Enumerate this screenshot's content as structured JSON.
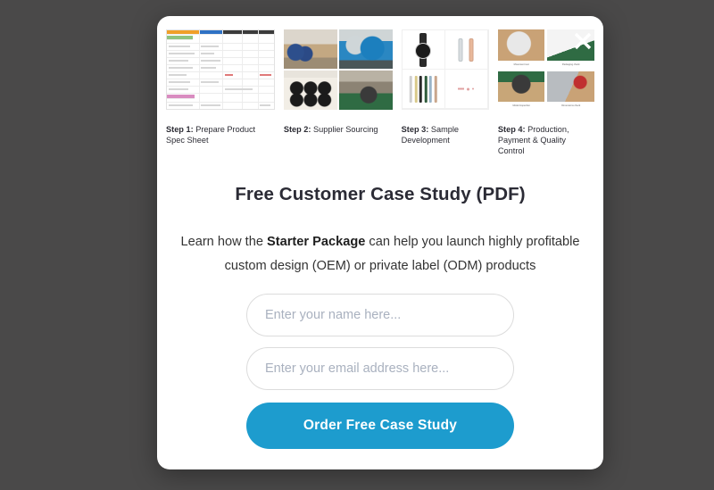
{
  "backdrop": {
    "color": "#4a4949"
  },
  "modal": {
    "close_icon": "close-icon",
    "title": "Free Customer Case Study (PDF)",
    "subtitle": {
      "lead": "Learn how the ",
      "highlight": "Starter Package",
      "rest": " can help you launch highly profitable custom design (OEM) or private label (ODM) products"
    },
    "accent_color": "#1d9cce",
    "title_color": "#2b2b35",
    "body_color": "#333333",
    "placeholder_color": "#a9b1bf",
    "input_border_color": "#dcdcdc"
  },
  "steps": [
    {
      "number": "Step 1:",
      "label": " Prepare Product Spec Sheet",
      "thumb": "spec-sheet-spreadsheet"
    },
    {
      "number": "Step 2:",
      "label": " Supplier Sourcing",
      "thumb": "factory-photo-grid"
    },
    {
      "number": "Step 3:",
      "label": " Sample Development",
      "thumb": "watch-samples-grid"
    },
    {
      "number": "Step 4:",
      "label": " Production, Payment & Quality Control",
      "thumb": "quality-control-photo-grid"
    }
  ],
  "qc_captions": [
    "Movement test",
    "Packaging check",
    "Model inspection",
    "Dimensions check"
  ],
  "form": {
    "name_value": "",
    "name_placeholder": "Enter your name here...",
    "email_value": "",
    "email_placeholder": "Enter your email address here...",
    "submit_label": "Order Free Case Study"
  }
}
